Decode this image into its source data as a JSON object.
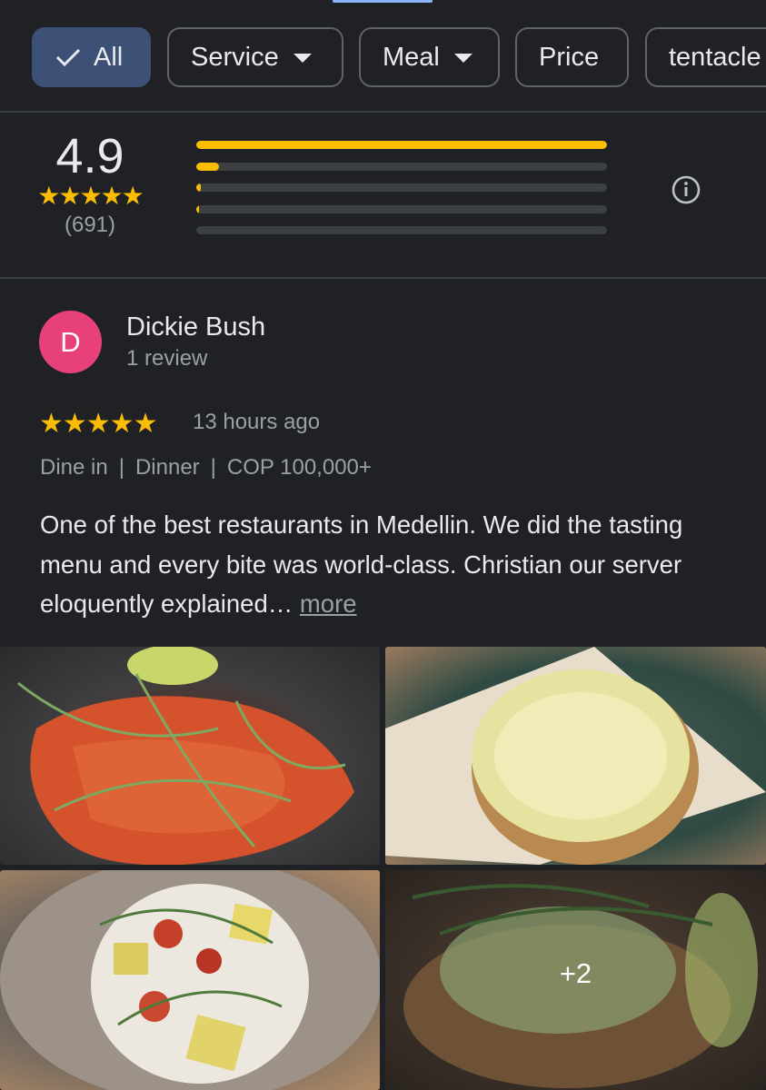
{
  "filters": {
    "chips": [
      {
        "label": "All",
        "selected": true,
        "dropdown": false
      },
      {
        "label": "Service",
        "selected": false,
        "dropdown": true
      },
      {
        "label": "Meal",
        "selected": false,
        "dropdown": true
      },
      {
        "label": "Price",
        "selected": false,
        "dropdown": false
      },
      {
        "label": "tentacle",
        "selected": false,
        "dropdown": false
      }
    ]
  },
  "rating_summary": {
    "average": "4.9",
    "stars": "★★★★★",
    "count": "(691)",
    "distribution": [
      {
        "stars": 5,
        "fraction": 1.0
      },
      {
        "stars": 4,
        "fraction": 0.055
      },
      {
        "stars": 3,
        "fraction": 0.01
      },
      {
        "stars": 2,
        "fraction": 0.004
      },
      {
        "stars": 1,
        "fraction": 0.0
      }
    ],
    "info_icon": "info-icon"
  },
  "review": {
    "avatar_letter": "D",
    "avatar_color": "#e8407a",
    "author": "Dickie Bush",
    "author_sub": "1 review",
    "stars": "★★★★★",
    "time": "13 hours ago",
    "tags": [
      "Dine in",
      "Dinner",
      "COP 100,000+"
    ],
    "text": "One of the best restaurants in Medellin. We did the tasting menu and every bite was world-class. Christian our server eloquently explained…",
    "more_label": "more",
    "photos_more": "+2"
  },
  "colors": {
    "background": "#202124",
    "star": "#fbbc04",
    "selected_chip": "#3c5175"
  }
}
